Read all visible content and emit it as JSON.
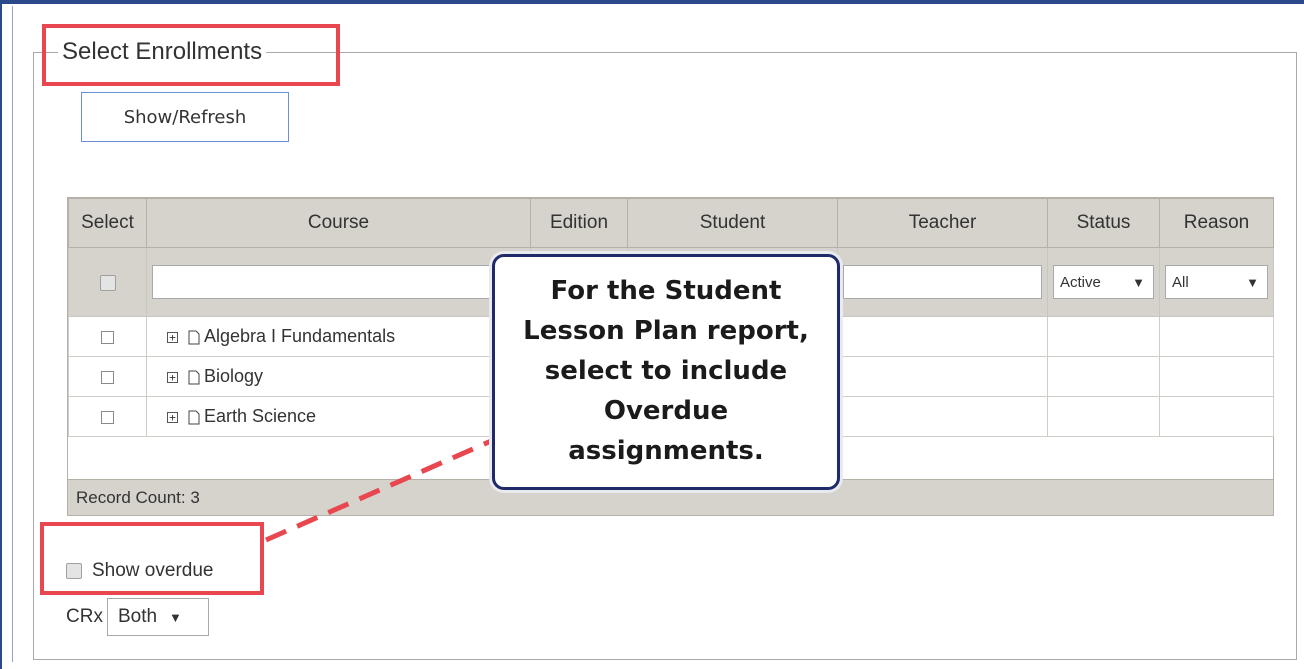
{
  "section": {
    "legend": "Select Enrollments",
    "refresh_label": "Show/Refresh"
  },
  "grid": {
    "columns": [
      "Select",
      "Course",
      "Edition",
      "Student",
      "Teacher",
      "Status",
      "Reason"
    ],
    "filters": {
      "status": "Active",
      "reason": "All"
    },
    "rows": [
      {
        "course": "Algebra I Fundamentals"
      },
      {
        "course": "Biology"
      },
      {
        "course": "Earth Science"
      }
    ],
    "record_count": "Record Count: 3"
  },
  "callout": {
    "text": "For the Student\nLesson Plan report,\nselect to include\nOverdue\nassignments."
  },
  "options": {
    "show_overdue_label": "Show overdue",
    "crx_label": "CRx",
    "crx_value": "Both"
  },
  "colors": {
    "highlight": "#e8474f",
    "callout_border": "#1f2a6b",
    "frame": "#2b4a8c"
  }
}
